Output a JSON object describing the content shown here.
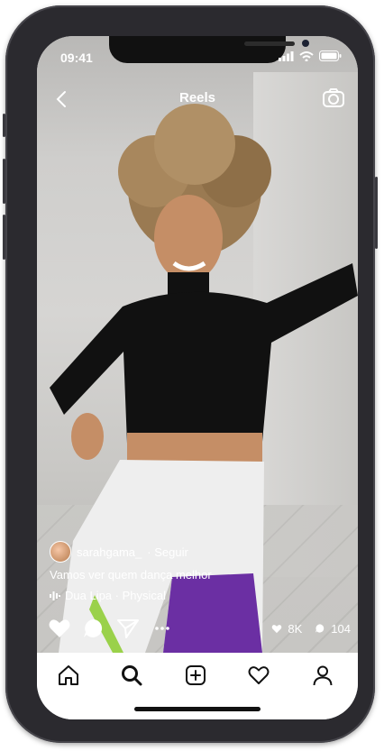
{
  "status": {
    "time": "09:41"
  },
  "header": {
    "title": "Reels"
  },
  "post": {
    "username": "sarahgama_",
    "follow_label": "· Seguir",
    "caption": "Vamos ver quem dança melhor",
    "music": "Dua Lipa · Physical",
    "likes": "8K",
    "comments": "104"
  },
  "colors": {
    "accent_purple": "#6b2fa3",
    "top_black": "#111111",
    "pants_white": "#eeeeee"
  },
  "icons": [
    "back-icon",
    "camera-icon",
    "heart-icon",
    "comment-icon",
    "send-icon",
    "more-icon",
    "home-icon",
    "search-icon",
    "add-icon",
    "activity-icon",
    "profile-icon"
  ]
}
